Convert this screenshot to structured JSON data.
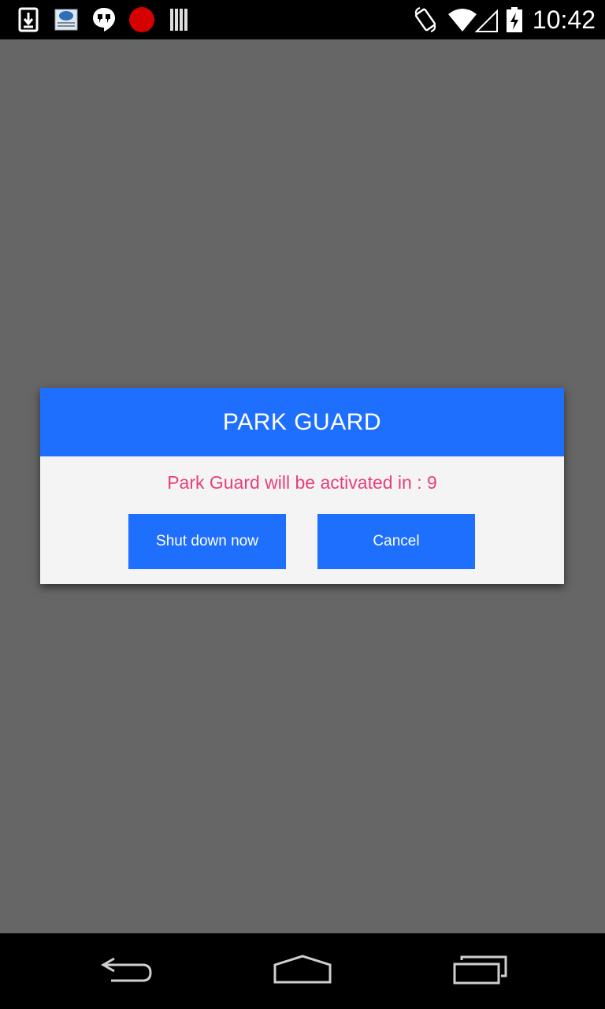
{
  "status_bar": {
    "time": "10:42",
    "left_icons": [
      "download-icon",
      "weather-icon",
      "hangouts-icon",
      "record-icon",
      "barcode-icon"
    ],
    "right_icons": [
      "rotate-icon",
      "wifi-icon",
      "battery-charging-icon"
    ]
  },
  "dialog": {
    "title": "PARK GUARD",
    "message": "Park Guard will be activated in : 9",
    "buttons": {
      "shutdown_label": "Shut down now",
      "cancel_label": "Cancel"
    }
  },
  "nav_bar": {
    "icons": [
      "back-icon",
      "home-icon",
      "recent-apps-icon"
    ]
  },
  "colors": {
    "accent": "#1f6ffe",
    "message_text": "#e8407a",
    "background_dim": "#666666"
  }
}
